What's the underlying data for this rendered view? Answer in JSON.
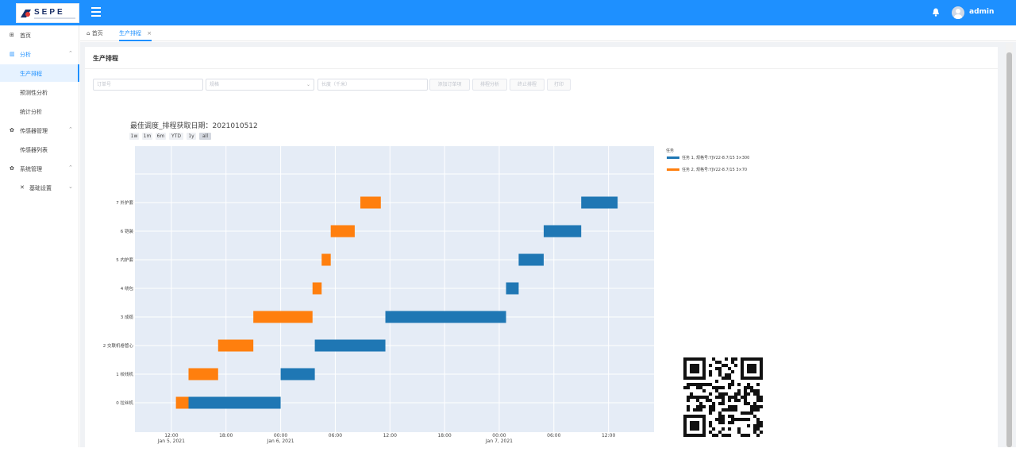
{
  "header": {
    "logo_text": "SEPE",
    "username": "admin"
  },
  "sidebar": {
    "items": [
      {
        "label": "首页",
        "icon": "grid-icon"
      },
      {
        "label": "分析",
        "icon": "bar-chart-icon"
      },
      {
        "label": "生产排程"
      },
      {
        "label": "预测性分析"
      },
      {
        "label": "统计分析"
      },
      {
        "label": "传感器管理",
        "icon": "gear-icon"
      },
      {
        "label": "传感器列表"
      },
      {
        "label": "系统管理",
        "icon": "gear-icon"
      },
      {
        "label": "基础设置",
        "icon": "tools-icon"
      }
    ]
  },
  "tabs": [
    {
      "label": "首页"
    },
    {
      "label": "生产排程",
      "close": "×"
    }
  ],
  "panel": {
    "title": "生产排程",
    "order_placeholder": "订单号",
    "spec_placeholder": "规格",
    "length_placeholder": "长度（千米）",
    "buttons": [
      "添加订单项",
      "排程分析",
      "终止排程",
      "打印"
    ]
  },
  "colors": {
    "header": "#1e90ff",
    "task1": "#1f77b4",
    "task2": "#ff7f0e",
    "plot_bg": "#e5ecf6"
  },
  "chart_data": {
    "type": "gantt",
    "title": "最佳调度_排程获取日期：2021010512",
    "range_buttons": [
      "1w",
      "1m",
      "6m",
      "YTD",
      "1y",
      "all"
    ],
    "selected_range": "all",
    "x_ticks": [
      {
        "time": "12:00",
        "date": "Jan 5, 2021"
      },
      {
        "time": "18:00",
        "date": ""
      },
      {
        "time": "00:00",
        "date": "Jan 6, 2021"
      },
      {
        "time": "06:00",
        "date": ""
      },
      {
        "time": "12:00",
        "date": ""
      },
      {
        "time": "18:00",
        "date": ""
      },
      {
        "time": "00:00",
        "date": "Jan 7, 2021"
      },
      {
        "time": "06:00",
        "date": ""
      },
      {
        "time": "12:00",
        "date": ""
      }
    ],
    "xlim": [
      "2021-01-05 08:00",
      "2021-01-07 17:00"
    ],
    "machines": [
      "0 拉丝机",
      "1 绞线机",
      "2 交联机卷管心",
      "3 成缆",
      "4 绕包",
      "5 内护套",
      "6 铠装",
      "7 外护套"
    ],
    "legend_title": "任务",
    "legend_position": "top-right",
    "series": [
      {
        "name": "任务 1, 规格号:YJV22-8.7/15 3×300",
        "color": "#1f77b4",
        "tasks": [
          {
            "machine": 0,
            "start": "2021-01-05 13:53",
            "end": "2021-01-06 00:00"
          },
          {
            "machine": 1,
            "start": "2021-01-06 00:00",
            "end": "2021-01-06 03:45"
          },
          {
            "machine": 2,
            "start": "2021-01-06 03:45",
            "end": "2021-01-06 11:30"
          },
          {
            "machine": 3,
            "start": "2021-01-06 11:30",
            "end": "2021-01-07 00:45"
          },
          {
            "machine": 4,
            "start": "2021-01-07 00:45",
            "end": "2021-01-07 02:08"
          },
          {
            "machine": 5,
            "start": "2021-01-07 02:08",
            "end": "2021-01-07 04:53"
          },
          {
            "machine": 6,
            "start": "2021-01-07 04:53",
            "end": "2021-01-07 09:00"
          },
          {
            "machine": 7,
            "start": "2021-01-07 09:00",
            "end": "2021-01-07 13:00"
          }
        ]
      },
      {
        "name": "任务 2, 规格号:YJV22-8.7/15 3×70",
        "color": "#ff7f0e",
        "tasks": [
          {
            "machine": 0,
            "start": "2021-01-05 12:30",
            "end": "2021-01-05 13:53"
          },
          {
            "machine": 1,
            "start": "2021-01-05 13:53",
            "end": "2021-01-05 17:08"
          },
          {
            "machine": 2,
            "start": "2021-01-05 17:08",
            "end": "2021-01-05 21:00"
          },
          {
            "machine": 3,
            "start": "2021-01-05 21:00",
            "end": "2021-01-06 03:30"
          },
          {
            "machine": 4,
            "start": "2021-01-06 03:30",
            "end": "2021-01-06 04:30"
          },
          {
            "machine": 5,
            "start": "2021-01-06 04:30",
            "end": "2021-01-06 05:30"
          },
          {
            "machine": 6,
            "start": "2021-01-06 05:30",
            "end": "2021-01-06 08:08"
          },
          {
            "machine": 7,
            "start": "2021-01-06 08:45",
            "end": "2021-01-06 11:00"
          }
        ]
      }
    ],
    "grid": true
  }
}
